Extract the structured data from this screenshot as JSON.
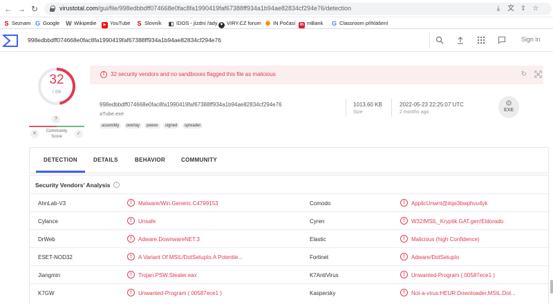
{
  "browser": {
    "url_host": "virustotal.com",
    "url_path": "/gui/file/998edbbdff074668e0fac8fa1990419faf67388ff934a1b94ae82834cf294e76/detection",
    "bookmarks": [
      {
        "label": "Seznam",
        "icon": "seznam-s-icon",
        "color": "#cc0000"
      },
      {
        "label": "Google",
        "icon": "google-g-icon",
        "color": "#4285f4"
      },
      {
        "label": "Wikipedie",
        "icon": "wikipedia-w-icon",
        "color": "#555555"
      },
      {
        "label": "YouTube",
        "icon": "youtube-play-icon",
        "color": "#ff0000"
      },
      {
        "label": "Slovník",
        "icon": "seznam-s-icon",
        "color": "#cc0000"
      },
      {
        "label": "IDOS - jízdní řády",
        "icon": "idos-icon",
        "color": "#333333"
      },
      {
        "label": "VIRY.CZ forum",
        "icon": "viry-icon",
        "color": "#2a2a2a"
      },
      {
        "label": "IN Počasí",
        "icon": "sun-icon",
        "color": "#f08c00"
      },
      {
        "label": "mBank",
        "icon": "mbank-icon",
        "color": "#d4213d"
      },
      {
        "label": "Classroom přihlášení",
        "icon": "google-g-icon",
        "color": "#4285f4"
      }
    ]
  },
  "header": {
    "search_value": "998edbbdff074668e0fac8fa1990419faf67388ff934a1b94ae82834cf294e76",
    "signin_label": "Sign in"
  },
  "score": {
    "detections": "32",
    "total": "/ 68",
    "community_placeholder": "?",
    "community_label_1": "Community",
    "community_label_2": "Score"
  },
  "summary": {
    "alert_text": "32 security vendors and no sandboxes flagged this file as malicious",
    "file_hash": "998edbbdff074668e0fac8fa1990419faf67388ff934a1b94ae82834cf294e76",
    "file_name": "aTube.exe",
    "tags": [
      "assembly",
      "overlay",
      "peexe",
      "signed",
      "spreader"
    ],
    "size_value": "1013.60 KB",
    "size_label": "Size",
    "date_value": "2022-05-23 22:25:07 UTC",
    "date_relative": "2 months ago",
    "filetype_label": "EXE"
  },
  "tabs": [
    "DETECTION",
    "DETAILS",
    "BEHAVIOR",
    "COMMUNITY"
  ],
  "analysis": {
    "title": "Security Vendors' Analysis",
    "rows": [
      {
        "v1": "AhnLab-V3",
        "r1": "Malware/Win.Generic.C4799153",
        "v2": "Comodo",
        "r2": "ApplicUnwnt@#qe3bwphvu4yk"
      },
      {
        "v1": "Cylance",
        "r1": "Unsafe",
        "v2": "Cyren",
        "r2": "W32/MSIL_Kryptik.GAT.gen!Eldorado"
      },
      {
        "v1": "DrWeb",
        "r1": "Adware.DownwareNET.3",
        "v2": "Elastic",
        "r2": "Malicious (high Confidence)"
      },
      {
        "v1": "ESET-NOD32",
        "r1": "A Variant Of MSIL/DotSetupIo.A Potentie...",
        "v2": "Fortinet",
        "r2": "Adware/DotSetupIo"
      },
      {
        "v1": "Jiangmin",
        "r1": "Trojan.PSW.Stealer.eax",
        "v2": "K7AntiVirus",
        "r2": "Unwanted-Program ( 00587ece1 )"
      },
      {
        "v1": "K7GW",
        "r1": "Unwanted-Program ( 00587ece1 )",
        "v2": "Kaspersky",
        "r2": "Not-a-virus:HEUR:Downloader.MSIL.Dot..."
      }
    ]
  },
  "colors": {
    "malicious": "#e03a4f",
    "accent": "#3b61f6",
    "alert_bg": "#fbeeee"
  }
}
